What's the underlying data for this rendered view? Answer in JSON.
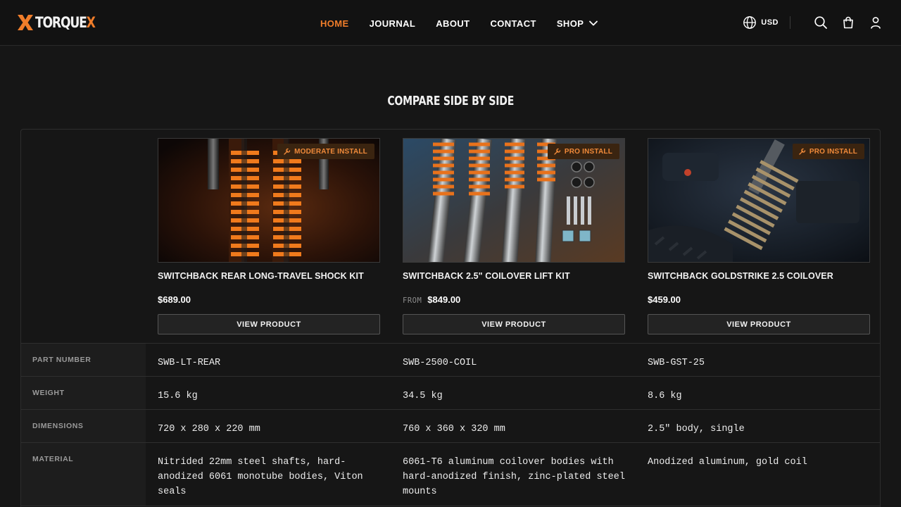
{
  "brand": {
    "name_main": "TORQUE",
    "name_accent": "X"
  },
  "nav": {
    "items": [
      {
        "label": "HOME",
        "active": true
      },
      {
        "label": "JOURNAL"
      },
      {
        "label": "ABOUT"
      },
      {
        "label": "CONTACT"
      },
      {
        "label": "SHOP"
      }
    ]
  },
  "header": {
    "currency": "USD"
  },
  "colors": {
    "accent": "#f07d2a",
    "background": "#161616",
    "header": "#121212"
  },
  "compare": {
    "title": "COMPARE SIDE BY SIDE",
    "products": [
      {
        "badge": "MODERATE INSTALL",
        "name": "SWITCHBACK REAR LONG-TRAVEL SHOCK KIT",
        "from": "",
        "price": "$689.00",
        "button": "VIEW PRODUCT"
      },
      {
        "badge": "PRO INSTALL",
        "name": "SWITCHBACK 2.5\" COILOVER LIFT KIT",
        "from": "FROM",
        "price": "$849.00",
        "button": "VIEW PRODUCT"
      },
      {
        "badge": "PRO INSTALL",
        "name": "SWITCHBACK GOLDSTRIKE 2.5 COILOVER",
        "from": "",
        "price": "$459.00",
        "button": "VIEW PRODUCT"
      }
    ],
    "specs": [
      {
        "label": "PART NUMBER",
        "values": [
          "SWB-LT-REAR",
          "SWB-2500-COIL",
          "SWB-GST-25"
        ]
      },
      {
        "label": "WEIGHT",
        "values": [
          "15.6 kg",
          "34.5 kg",
          "8.6 kg"
        ]
      },
      {
        "label": "DIMENSIONS",
        "values": [
          "720 x 280 x 220 mm",
          "760 x 360 x 320 mm",
          "2.5\" body, single"
        ]
      },
      {
        "label": "MATERIAL",
        "values": [
          "Nitrided 22mm steel shafts, hard-anodized 6061 monotube bodies, Viton seals",
          "6061-T6 aluminum coilover bodies with hard-anodized finish, zinc-plated steel mounts",
          "Anodized aluminum, gold coil"
        ]
      }
    ]
  }
}
